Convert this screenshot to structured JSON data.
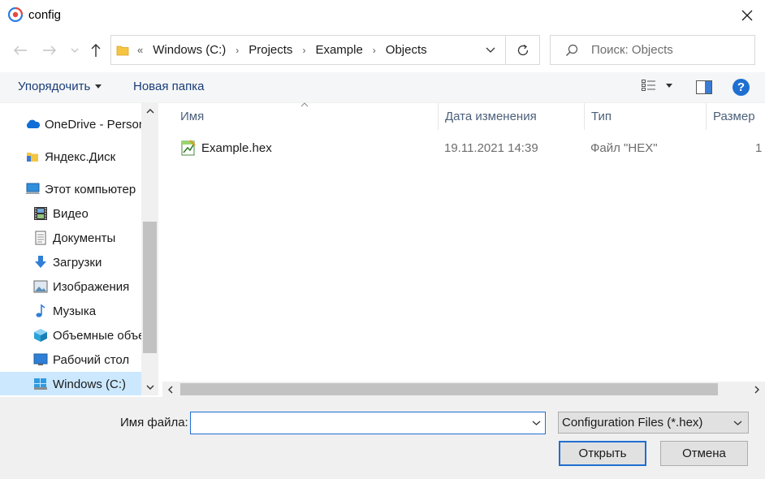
{
  "window": {
    "title": "config",
    "close_icon": "close-icon"
  },
  "address": {
    "overflow": "«",
    "crumbs": [
      "Windows (C:)",
      "Projects",
      "Example",
      "Objects"
    ],
    "separator": "›"
  },
  "search": {
    "placeholder": "Поиск: Objects"
  },
  "toolbar": {
    "organize_label": "Упорядочить",
    "new_folder_label": "Новая папка",
    "help_label": "?"
  },
  "sidebar": {
    "items": [
      {
        "label": "OneDrive - Person",
        "icon": "onedrive-icon"
      },
      {
        "label": "Яндекс.Диск",
        "icon": "yandex-disk-icon"
      },
      {
        "label": "Этот компьютер",
        "icon": "computer-icon"
      },
      {
        "label": "Видео",
        "icon": "video-icon"
      },
      {
        "label": "Документы",
        "icon": "documents-icon"
      },
      {
        "label": "Загрузки",
        "icon": "downloads-icon"
      },
      {
        "label": "Изображения",
        "icon": "pictures-icon"
      },
      {
        "label": "Музыка",
        "icon": "music-icon"
      },
      {
        "label": "Объемные объекты",
        "icon": "3d-objects-icon"
      },
      {
        "label": "Рабочий стол",
        "icon": "desktop-icon"
      },
      {
        "label": "Windows (C:)",
        "icon": "drive-icon",
        "selected": true
      }
    ]
  },
  "filelist": {
    "columns": [
      "Имя",
      "Дата изменения",
      "Тип",
      "Размер"
    ],
    "rows": [
      {
        "name": "Example.hex",
        "date": "19.11.2021 14:39",
        "type": "Файл \"HEX\"",
        "size": "1"
      }
    ]
  },
  "footer": {
    "filename_label": "Имя файла:",
    "filename_value": "",
    "filetype_value": "Configuration Files (*.hex)",
    "open_label": "Открыть",
    "cancel_label": "Отмена"
  },
  "colors": {
    "accent": "#1f6fd1",
    "selection": "#cce8ff",
    "link": "#1a3d7a"
  }
}
